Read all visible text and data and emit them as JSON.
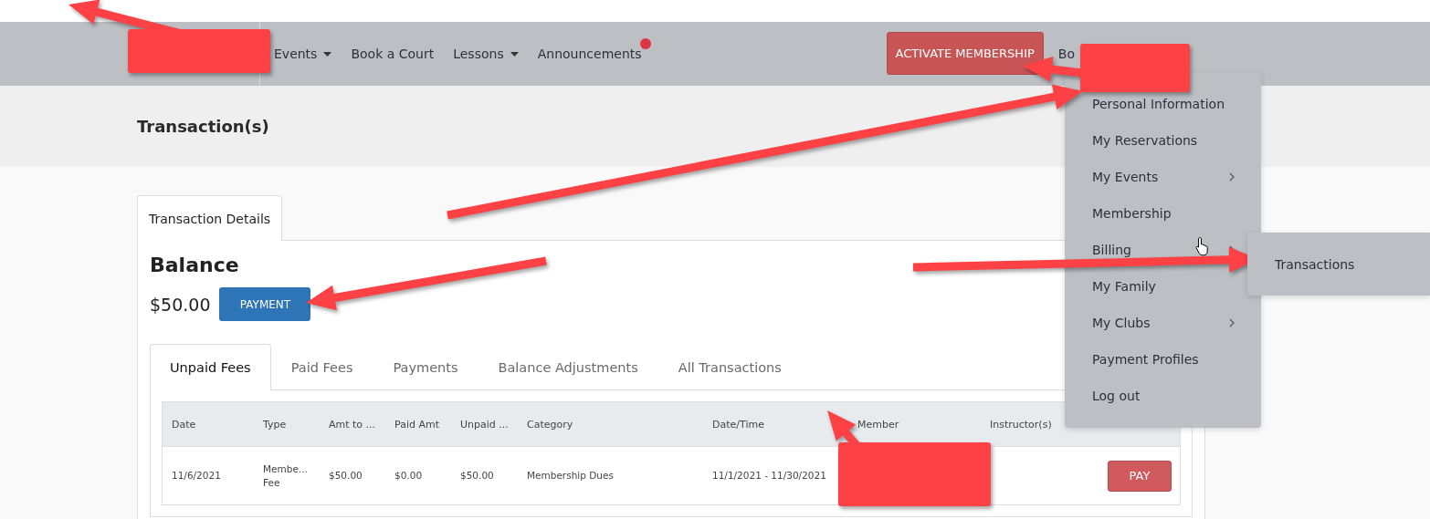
{
  "nav": {
    "items": [
      {
        "label": "Events",
        "has_dropdown": true,
        "has_notification": false
      },
      {
        "label": "Book a Court",
        "has_dropdown": false,
        "has_notification": false
      },
      {
        "label": "Lessons",
        "has_dropdown": true,
        "has_notification": false
      },
      {
        "label": "Announcements",
        "has_dropdown": false,
        "has_notification": true
      }
    ],
    "cta": "ACTIVATE MEMBERSHIP",
    "user": "Bo"
  },
  "user_menu": {
    "items": [
      {
        "label": "Personal Information",
        "has_submenu": false
      },
      {
        "label": "My Reservations",
        "has_submenu": false
      },
      {
        "label": "My Events",
        "has_submenu": true
      },
      {
        "label": "Membership",
        "has_submenu": false
      },
      {
        "label": "Billing",
        "has_submenu": true,
        "children": [
          {
            "label": "Transactions"
          }
        ]
      },
      {
        "label": "My Family",
        "has_submenu": false
      },
      {
        "label": "My Clubs",
        "has_submenu": true
      },
      {
        "label": "Payment Profiles",
        "has_submenu": false
      },
      {
        "label": "Log out",
        "has_submenu": false
      }
    ]
  },
  "page_title": "Transaction(s)",
  "card_tab": "Transaction Details",
  "balance": {
    "title": "Balance",
    "amount": "$50.00",
    "button": "PAYMENT"
  },
  "tabs": [
    {
      "label": "Unpaid Fees",
      "selected": true
    },
    {
      "label": "Paid Fees",
      "selected": false
    },
    {
      "label": "Payments",
      "selected": false
    },
    {
      "label": "Balance Adjustments",
      "selected": false
    },
    {
      "label": "All Transactions",
      "selected": false
    }
  ],
  "table": {
    "columns": [
      "Date",
      "Type",
      "Amt to ...",
      "Paid Amt",
      "Unpaid ...",
      "Category",
      "Date/Time",
      "Member",
      "Instructor(s)"
    ],
    "rows": [
      {
        "cells": [
          "11/6/2021",
          "Membe... Fee",
          "$50.00",
          "$0.00",
          "$50.00",
          "Membership Dues",
          "11/1/2021 - 11/30/2021",
          "",
          ""
        ],
        "action": "PAY"
      }
    ]
  },
  "annotations": [
    {
      "kind": "arrow"
    },
    {
      "kind": "redaction"
    },
    {
      "kind": "arrow"
    },
    {
      "kind": "redaction"
    },
    {
      "kind": "arrow"
    },
    {
      "kind": "arrow"
    },
    {
      "kind": "arrow"
    },
    {
      "kind": "arrow"
    },
    {
      "kind": "redaction"
    }
  ]
}
